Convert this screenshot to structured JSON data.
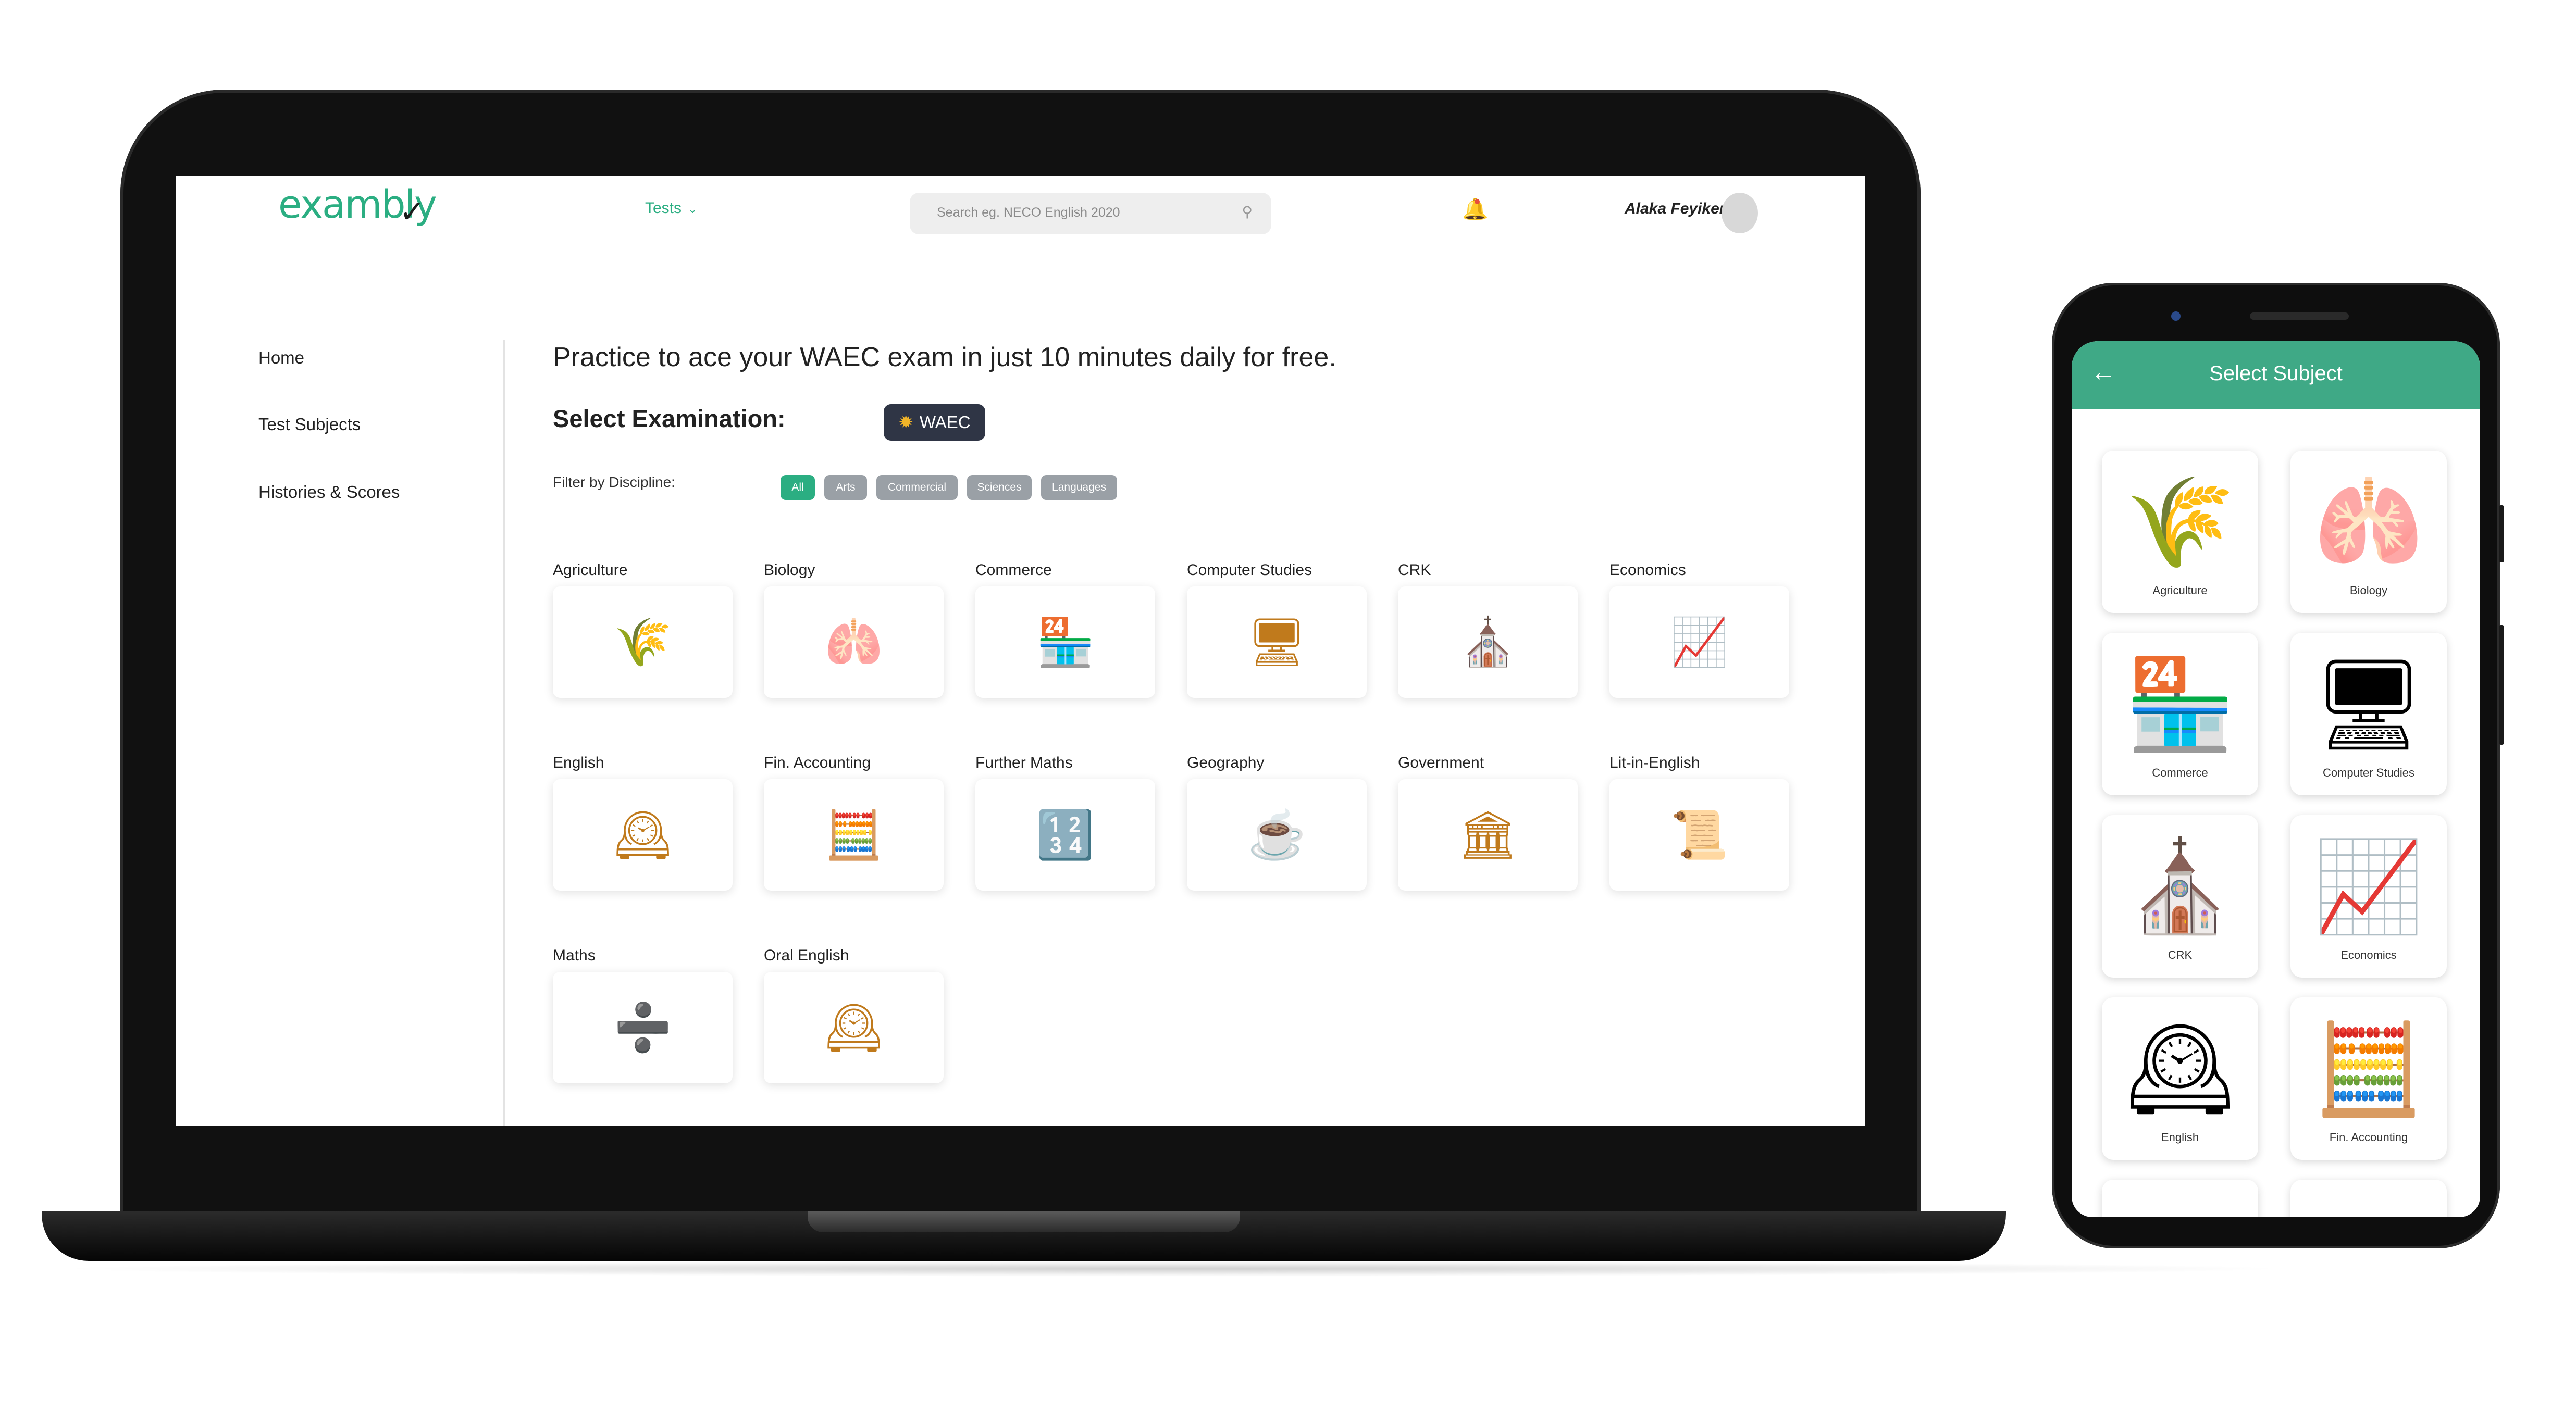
{
  "laptop": {
    "header": {
      "logo": "exambly",
      "logo_mark": "✓",
      "nav_tests": "Tests",
      "search_placeholder": "Search eg. NECO English 2020",
      "username": "Alaka Feyikemi"
    },
    "sidebar": {
      "items": [
        {
          "label": "Home"
        },
        {
          "label": "Test Subjects"
        },
        {
          "label": "Histories & Scores"
        }
      ]
    },
    "main": {
      "tagline": "Practice to ace your WAEC exam in just 10 minutes daily for free.",
      "select_exam_label": "Select Examination:",
      "exam_pill": "WAEC",
      "filter_label": "Filter by Discipline:",
      "filters": [
        "All",
        "Arts",
        "Commercial",
        "Sciences",
        "Languages"
      ],
      "subjects": [
        {
          "label": "Agriculture",
          "icon": "wheat-icon",
          "glyph": "🌾"
        },
        {
          "label": "Biology",
          "icon": "lungs-icon",
          "glyph": "🫁"
        },
        {
          "label": "Commerce",
          "icon": "shop-icon",
          "glyph": "🏪"
        },
        {
          "label": "Computer Studies",
          "icon": "cpu-icon",
          "glyph": "🖥"
        },
        {
          "label": "CRK",
          "icon": "church-icon",
          "glyph": "⛪"
        },
        {
          "label": "Economics",
          "icon": "growth-chart-icon",
          "glyph": "📈"
        },
        {
          "label": "English",
          "icon": "big-ben-icon",
          "glyph": "🕰"
        },
        {
          "label": "Fin. Accounting",
          "icon": "calculator-icon",
          "glyph": "🧮"
        },
        {
          "label": "Further Maths",
          "icon": "scientific-calculator-icon",
          "glyph": "🔢"
        },
        {
          "label": "Geography",
          "icon": "coffee-cup-icon",
          "glyph": "☕"
        },
        {
          "label": "Government",
          "icon": "capitol-icon",
          "glyph": "🏛"
        },
        {
          "label": "Lit-in-English",
          "icon": "shakespeare-icon",
          "glyph": "📜"
        },
        {
          "label": "Maths",
          "icon": "math-symbols-icon",
          "glyph": "➗"
        },
        {
          "label": "Oral English",
          "icon": "big-ben-icon",
          "glyph": "🕰"
        }
      ]
    }
  },
  "phone": {
    "title": "Select Subject",
    "subjects": [
      {
        "label": "Agriculture",
        "icon": "wheat-icon",
        "glyph": "🌾"
      },
      {
        "label": "Biology",
        "icon": "lungs-icon",
        "glyph": "🫁"
      },
      {
        "label": "Commerce",
        "icon": "shop-icon",
        "glyph": "🏪"
      },
      {
        "label": "Computer Studies",
        "icon": "cpu-icon",
        "glyph": "🖥"
      },
      {
        "label": "CRK",
        "icon": "church-icon",
        "glyph": "⛪"
      },
      {
        "label": "Economics",
        "icon": "growth-chart-icon",
        "glyph": "📈"
      },
      {
        "label": "English",
        "icon": "big-ben-icon",
        "glyph": "🕰"
      },
      {
        "label": "Fin. Accounting",
        "icon": "calculator-icon",
        "glyph": "🧮"
      }
    ]
  },
  "colors": {
    "brand": "#2bae82",
    "phone_bar": "#3fa986",
    "chip_inactive": "#9aa0a6",
    "exam_pill": "#2f3545"
  }
}
